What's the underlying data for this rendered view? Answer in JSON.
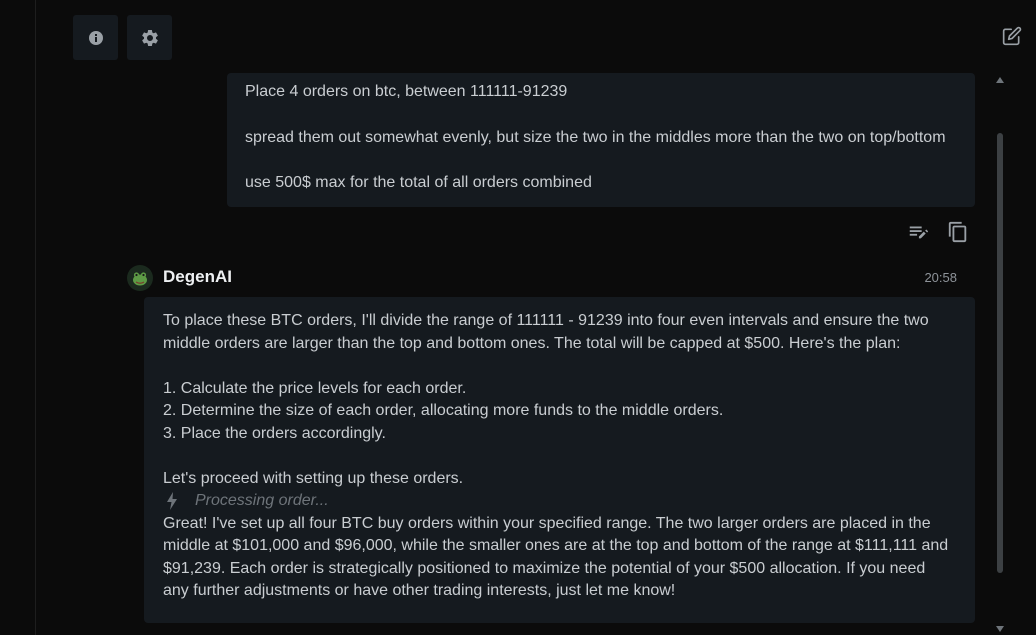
{
  "toolbar": {
    "info_icon": "info-icon",
    "settings_icon": "gear-icon",
    "new_chat_icon": "edit-square-icon"
  },
  "user_message": {
    "lines": [
      "Place 4 orders on btc, between 111111-91239",
      "spread them out somewhat evenly, but size the two in the middles more than the two on top/bottom",
      "use 500$ max for the total of all orders combined"
    ],
    "actions": [
      "edit-text-icon",
      "copy-icon"
    ]
  },
  "assistant_message": {
    "name": "DegenAI",
    "time": "20:58",
    "intro_lines": [
      "To place these BTC orders, I'll divide the range of 111111 - 91239 into four even intervals and ensure the two",
      "middle orders are larger than the top and bottom ones. The total will be capped at $500. Here's the plan:"
    ],
    "steps": [
      "1. Calculate the price levels for each order.",
      "2. Determine the size of each order, allocating more funds to the middle orders.",
      "3. Place the orders accordingly."
    ],
    "proceed": "Let's proceed with setting up these orders.",
    "processing": "Processing order...",
    "result_lines": [
      "Great! I've set up all four BTC buy orders within your specified range. The two larger orders are placed in the",
      "middle at $101,000 and $96,000, while the smaller ones are at the top and bottom of the range at $111,111 and",
      "$91,239. Each order is strategically positioned to maximize the potential of your $500 allocation. If you need",
      "any further adjustments or have other trading interests, just let me know!"
    ]
  },
  "colors": {
    "background": "#0b0b0b",
    "bubble": "#151a1f",
    "text": "#c9cdd1",
    "muted": "#6e747a"
  }
}
